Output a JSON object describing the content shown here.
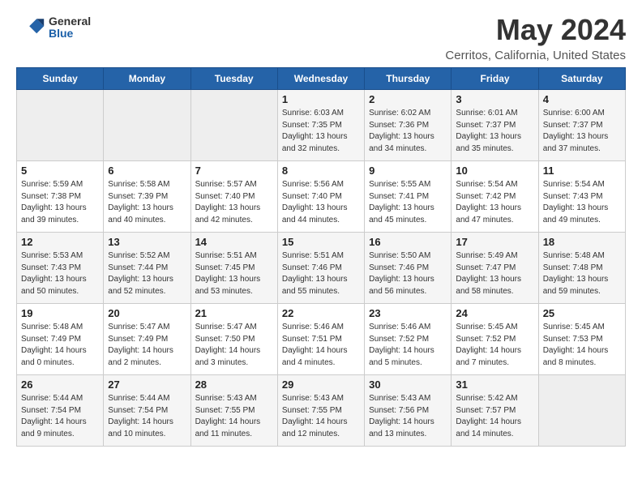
{
  "header": {
    "logo_general": "General",
    "logo_blue": "Blue",
    "title": "May 2024",
    "subtitle": "Cerritos, California, United States"
  },
  "weekdays": [
    "Sunday",
    "Monday",
    "Tuesday",
    "Wednesday",
    "Thursday",
    "Friday",
    "Saturday"
  ],
  "weeks": [
    [
      {
        "day": "",
        "sunrise": "",
        "sunset": "",
        "daylight": ""
      },
      {
        "day": "",
        "sunrise": "",
        "sunset": "",
        "daylight": ""
      },
      {
        "day": "",
        "sunrise": "",
        "sunset": "",
        "daylight": ""
      },
      {
        "day": "1",
        "sunrise": "Sunrise: 6:03 AM",
        "sunset": "Sunset: 7:35 PM",
        "daylight": "Daylight: 13 hours and 32 minutes."
      },
      {
        "day": "2",
        "sunrise": "Sunrise: 6:02 AM",
        "sunset": "Sunset: 7:36 PM",
        "daylight": "Daylight: 13 hours and 34 minutes."
      },
      {
        "day": "3",
        "sunrise": "Sunrise: 6:01 AM",
        "sunset": "Sunset: 7:37 PM",
        "daylight": "Daylight: 13 hours and 35 minutes."
      },
      {
        "day": "4",
        "sunrise": "Sunrise: 6:00 AM",
        "sunset": "Sunset: 7:37 PM",
        "daylight": "Daylight: 13 hours and 37 minutes."
      }
    ],
    [
      {
        "day": "5",
        "sunrise": "Sunrise: 5:59 AM",
        "sunset": "Sunset: 7:38 PM",
        "daylight": "Daylight: 13 hours and 39 minutes."
      },
      {
        "day": "6",
        "sunrise": "Sunrise: 5:58 AM",
        "sunset": "Sunset: 7:39 PM",
        "daylight": "Daylight: 13 hours and 40 minutes."
      },
      {
        "day": "7",
        "sunrise": "Sunrise: 5:57 AM",
        "sunset": "Sunset: 7:40 PM",
        "daylight": "Daylight: 13 hours and 42 minutes."
      },
      {
        "day": "8",
        "sunrise": "Sunrise: 5:56 AM",
        "sunset": "Sunset: 7:40 PM",
        "daylight": "Daylight: 13 hours and 44 minutes."
      },
      {
        "day": "9",
        "sunrise": "Sunrise: 5:55 AM",
        "sunset": "Sunset: 7:41 PM",
        "daylight": "Daylight: 13 hours and 45 minutes."
      },
      {
        "day": "10",
        "sunrise": "Sunrise: 5:54 AM",
        "sunset": "Sunset: 7:42 PM",
        "daylight": "Daylight: 13 hours and 47 minutes."
      },
      {
        "day": "11",
        "sunrise": "Sunrise: 5:54 AM",
        "sunset": "Sunset: 7:43 PM",
        "daylight": "Daylight: 13 hours and 49 minutes."
      }
    ],
    [
      {
        "day": "12",
        "sunrise": "Sunrise: 5:53 AM",
        "sunset": "Sunset: 7:43 PM",
        "daylight": "Daylight: 13 hours and 50 minutes."
      },
      {
        "day": "13",
        "sunrise": "Sunrise: 5:52 AM",
        "sunset": "Sunset: 7:44 PM",
        "daylight": "Daylight: 13 hours and 52 minutes."
      },
      {
        "day": "14",
        "sunrise": "Sunrise: 5:51 AM",
        "sunset": "Sunset: 7:45 PM",
        "daylight": "Daylight: 13 hours and 53 minutes."
      },
      {
        "day": "15",
        "sunrise": "Sunrise: 5:51 AM",
        "sunset": "Sunset: 7:46 PM",
        "daylight": "Daylight: 13 hours and 55 minutes."
      },
      {
        "day": "16",
        "sunrise": "Sunrise: 5:50 AM",
        "sunset": "Sunset: 7:46 PM",
        "daylight": "Daylight: 13 hours and 56 minutes."
      },
      {
        "day": "17",
        "sunrise": "Sunrise: 5:49 AM",
        "sunset": "Sunset: 7:47 PM",
        "daylight": "Daylight: 13 hours and 58 minutes."
      },
      {
        "day": "18",
        "sunrise": "Sunrise: 5:48 AM",
        "sunset": "Sunset: 7:48 PM",
        "daylight": "Daylight: 13 hours and 59 minutes."
      }
    ],
    [
      {
        "day": "19",
        "sunrise": "Sunrise: 5:48 AM",
        "sunset": "Sunset: 7:49 PM",
        "daylight": "Daylight: 14 hours and 0 minutes."
      },
      {
        "day": "20",
        "sunrise": "Sunrise: 5:47 AM",
        "sunset": "Sunset: 7:49 PM",
        "daylight": "Daylight: 14 hours and 2 minutes."
      },
      {
        "day": "21",
        "sunrise": "Sunrise: 5:47 AM",
        "sunset": "Sunset: 7:50 PM",
        "daylight": "Daylight: 14 hours and 3 minutes."
      },
      {
        "day": "22",
        "sunrise": "Sunrise: 5:46 AM",
        "sunset": "Sunset: 7:51 PM",
        "daylight": "Daylight: 14 hours and 4 minutes."
      },
      {
        "day": "23",
        "sunrise": "Sunrise: 5:46 AM",
        "sunset": "Sunset: 7:52 PM",
        "daylight": "Daylight: 14 hours and 5 minutes."
      },
      {
        "day": "24",
        "sunrise": "Sunrise: 5:45 AM",
        "sunset": "Sunset: 7:52 PM",
        "daylight": "Daylight: 14 hours and 7 minutes."
      },
      {
        "day": "25",
        "sunrise": "Sunrise: 5:45 AM",
        "sunset": "Sunset: 7:53 PM",
        "daylight": "Daylight: 14 hours and 8 minutes."
      }
    ],
    [
      {
        "day": "26",
        "sunrise": "Sunrise: 5:44 AM",
        "sunset": "Sunset: 7:54 PM",
        "daylight": "Daylight: 14 hours and 9 minutes."
      },
      {
        "day": "27",
        "sunrise": "Sunrise: 5:44 AM",
        "sunset": "Sunset: 7:54 PM",
        "daylight": "Daylight: 14 hours and 10 minutes."
      },
      {
        "day": "28",
        "sunrise": "Sunrise: 5:43 AM",
        "sunset": "Sunset: 7:55 PM",
        "daylight": "Daylight: 14 hours and 11 minutes."
      },
      {
        "day": "29",
        "sunrise": "Sunrise: 5:43 AM",
        "sunset": "Sunset: 7:55 PM",
        "daylight": "Daylight: 14 hours and 12 minutes."
      },
      {
        "day": "30",
        "sunrise": "Sunrise: 5:43 AM",
        "sunset": "Sunset: 7:56 PM",
        "daylight": "Daylight: 14 hours and 13 minutes."
      },
      {
        "day": "31",
        "sunrise": "Sunrise: 5:42 AM",
        "sunset": "Sunset: 7:57 PM",
        "daylight": "Daylight: 14 hours and 14 minutes."
      },
      {
        "day": "",
        "sunrise": "",
        "sunset": "",
        "daylight": ""
      }
    ]
  ]
}
